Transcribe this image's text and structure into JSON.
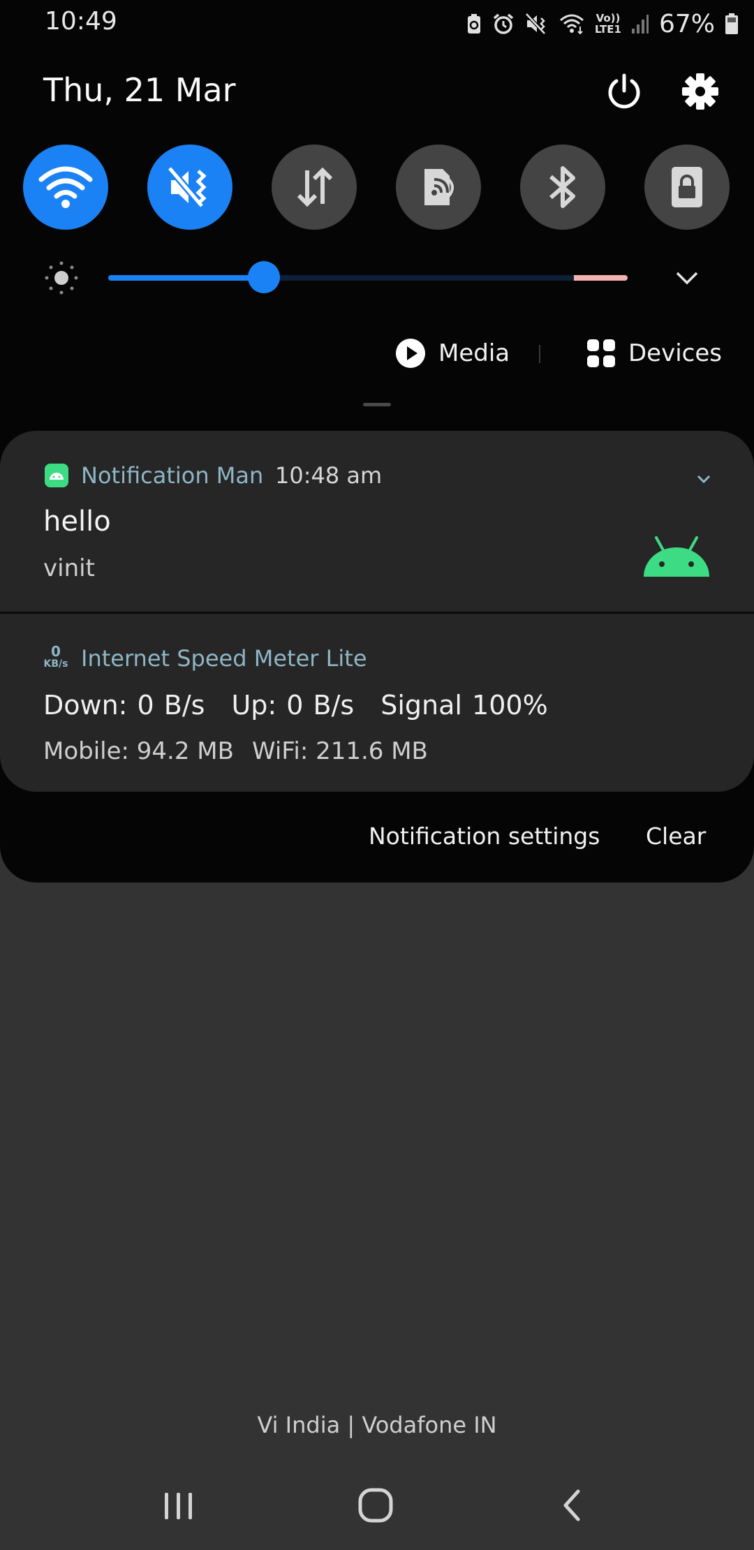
{
  "status_bar": {
    "time": "10:49",
    "battery_percent": "67%",
    "icons": [
      "battery-saver-icon",
      "alarm-icon",
      "mute-icon",
      "wifi-signal-icon",
      "volte-lte-icon",
      "cell-signal-icon",
      "battery-icon"
    ],
    "volte_label": "Vo))",
    "lte_label": "LTE1"
  },
  "header": {
    "date": "Thu, 21 Mar",
    "power_icon": "power-icon",
    "settings_icon": "gear-icon"
  },
  "quick_tiles": [
    {
      "name": "wifi",
      "icon": "wifi-icon",
      "state": "on"
    },
    {
      "name": "sound",
      "icon": "mute-vibrate-icon",
      "state": "on"
    },
    {
      "name": "mobile-data",
      "icon": "data-arrows-icon",
      "state": "off"
    },
    {
      "name": "screen-mirror",
      "icon": "screen-cast-icon",
      "state": "off"
    },
    {
      "name": "bluetooth",
      "icon": "bluetooth-icon",
      "state": "off"
    },
    {
      "name": "screen-lock",
      "icon": "lock-icon",
      "state": "off"
    }
  ],
  "brightness": {
    "level_fraction": 0.3,
    "colors": {
      "active": "#1b82f5",
      "track": "#0e1f38",
      "warning": "#f2b4b0"
    }
  },
  "media_bar": {
    "media_label": "Media",
    "devices_label": "Devices"
  },
  "notifications": {
    "first": {
      "app_name": "Notification Man",
      "time": "10:48 am",
      "title": "hello",
      "text": "vinit",
      "icon": "android-icon"
    },
    "second": {
      "app_icon_value": "0",
      "app_icon_unit": "KB/s",
      "app_name": "Internet Speed Meter Lite",
      "down": "Down: 0 B/s",
      "up": "Up: 0 B/s",
      "signal": "Signal 100%",
      "mobile": "Mobile: 94.2 MB",
      "wifi": "WiFi: 211.6 MB"
    }
  },
  "actions": {
    "notification_settings": "Notification settings",
    "clear": "Clear"
  },
  "carrier": "Vi India | Vodafone IN",
  "nav": {
    "recents_icon": "recents-icon",
    "home_icon": "home-icon",
    "back_icon": "back-icon"
  },
  "colors": {
    "accent": "#1b82f5",
    "panel_bg": "#050505",
    "card_bg": "#262626",
    "app_name": "#8fb6c6",
    "android_green": "#3ddc84"
  }
}
